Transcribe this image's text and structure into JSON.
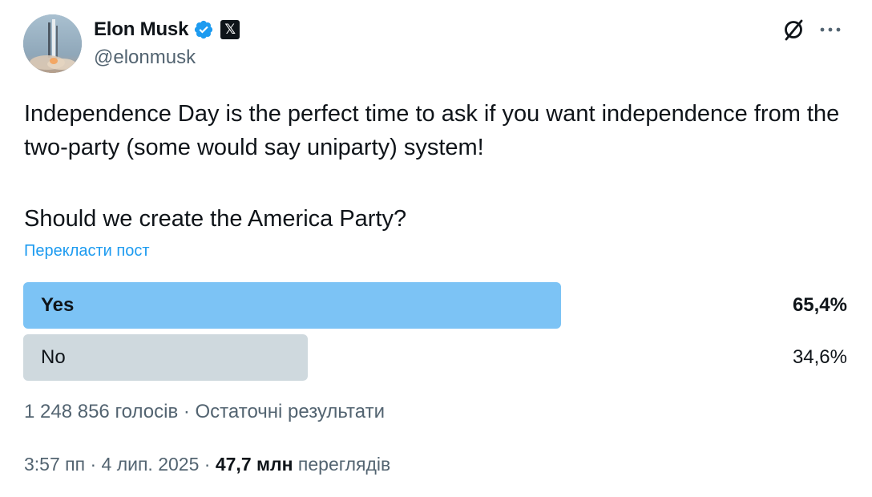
{
  "author": {
    "name": "Elon Musk",
    "handle": "@elonmusk",
    "verified_color": "#1d9bf0",
    "affiliate_badge": "𝕏"
  },
  "actions": {
    "grok_icon": "grok-slash-circle-icon",
    "more_icon": "more-dots-icon"
  },
  "tweet": {
    "text": "Independence Day is the perfect time to ask if you want independence from the two-party (some would say uniparty) system!",
    "question": "Should we create the America Party?",
    "translate_link": "Перекласти пост"
  },
  "poll": {
    "options": [
      {
        "label": "Yes",
        "percent_text": "65,4%",
        "fraction": 0.654,
        "color": "#7cc3f5",
        "winner": true
      },
      {
        "label": "No",
        "percent_text": "34,6%",
        "fraction": 0.346,
        "color": "#cfd9de",
        "winner": false
      }
    ],
    "votes_text": "1 248 856 голосів",
    "separator": " · ",
    "status_text": "Остаточні результати"
  },
  "meta": {
    "time": "3:57 пп",
    "date": "4 лип. 2025",
    "separator": " · ",
    "views_count": "47,7 млн",
    "views_label": "переглядів"
  }
}
